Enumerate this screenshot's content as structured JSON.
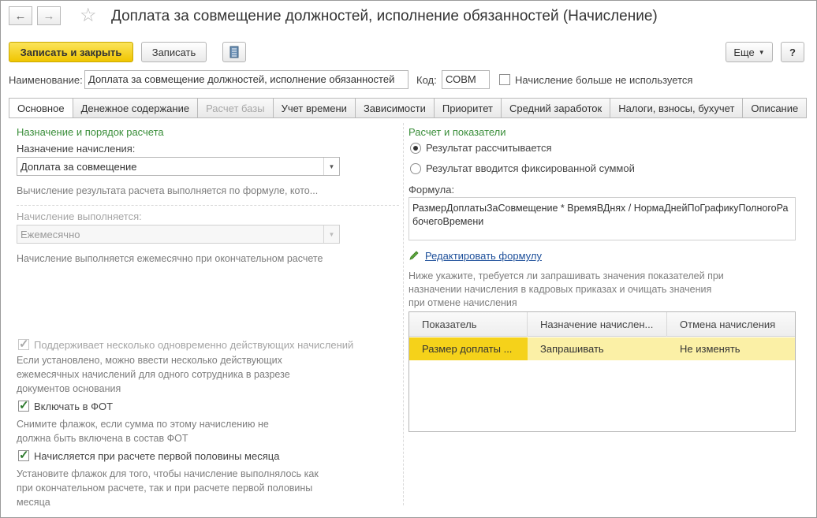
{
  "window": {
    "title": "Доплата за совмещение должностей, исполнение обязанностей (Начисление)",
    "back_icon": "arrow-left-icon",
    "forward_icon": "arrow-right-icon",
    "favorite_icon": "star-icon"
  },
  "toolbar": {
    "save_close_label": "Записать и закрыть",
    "save_label": "Записать",
    "more_label": "Еще",
    "help_label": "?"
  },
  "header": {
    "name_label": "Наименование:",
    "name_value": "Доплата за совмещение должностей, исполнение обязанностей",
    "code_label": "Код:",
    "code_value": "СОВМ",
    "unused_label": "Начисление больше не используется",
    "unused_checked": false
  },
  "tabs": [
    {
      "label": "Основное",
      "active": true,
      "disabled": false
    },
    {
      "label": "Денежное содержание",
      "active": false,
      "disabled": false
    },
    {
      "label": "Расчет базы",
      "active": false,
      "disabled": true
    },
    {
      "label": "Учет времени",
      "active": false,
      "disabled": false
    },
    {
      "label": "Зависимости",
      "active": false,
      "disabled": false
    },
    {
      "label": "Приоритет",
      "active": false,
      "disabled": false
    },
    {
      "label": "Средний заработок",
      "active": false,
      "disabled": false
    },
    {
      "label": "Налоги, взносы, бухучет",
      "active": false,
      "disabled": false
    },
    {
      "label": "Описание",
      "active": false,
      "disabled": false
    }
  ],
  "left": {
    "section_title": "Назначение и порядок расчета",
    "purpose_label": "Назначение начисления:",
    "purpose_value": "Доплата за совмещение",
    "purpose_hint": "Вычисление результата расчета выполняется по формуле, кото...",
    "period_label": "Начисление выполняется:",
    "period_value": "Ежемесячно",
    "period_hint": "Начисление выполняется ежемесячно при окончательном расчете",
    "multi_label": "Поддерживает несколько одновременно действующих начислений",
    "multi_checked": true,
    "multi_hint": "Если установлено, можно ввести несколько действующих ежемесячных начислений для одного сотрудника в разрезе документов основания",
    "fot_label": "Включать в ФОТ",
    "fot_checked": true,
    "fot_hint": "Снимите флажок, если сумма по этому начислению не должна быть включена в состав ФОТ",
    "half_label": "Начисляется при расчете первой половины месяца",
    "half_checked": true,
    "half_hint": "Установите флажок для того, чтобы начисление выполнялось как при окончательном расчете, так и при расчете первой половины месяца"
  },
  "right": {
    "section_title": "Расчет и показатели",
    "radio_calc_label": "Результат рассчитывается",
    "radio_fixed_label": "Результат вводится фиксированной суммой",
    "radio_selected": "calc",
    "formula_label": "Формула:",
    "formula_value": "РазмерДоплатыЗаСовмещение * ВремяВДнях / НормаДнейПоГрафикуПолногоРабочегоВремени",
    "edit_formula_label": "Редактировать формулу",
    "edit_icon": "pencil-icon",
    "indicators_hint": "Ниже укажите, требуется ли запрашивать значения показателей при назначении начисления в кадровых приказах и очищать значения при отмене начисления",
    "table": {
      "columns": [
        "Показатель",
        "Назначение начислен...",
        "Отмена начисления"
      ],
      "rows": [
        [
          "Размер доплаты ...",
          "Запрашивать",
          "Не изменять"
        ]
      ]
    }
  },
  "colors": {
    "primary_button": "#f5cf1a",
    "section_title": "#3a8e3a",
    "selected_row": "#fbf0a6",
    "current_cell": "#f5d21a",
    "link": "#1d4f9a"
  }
}
